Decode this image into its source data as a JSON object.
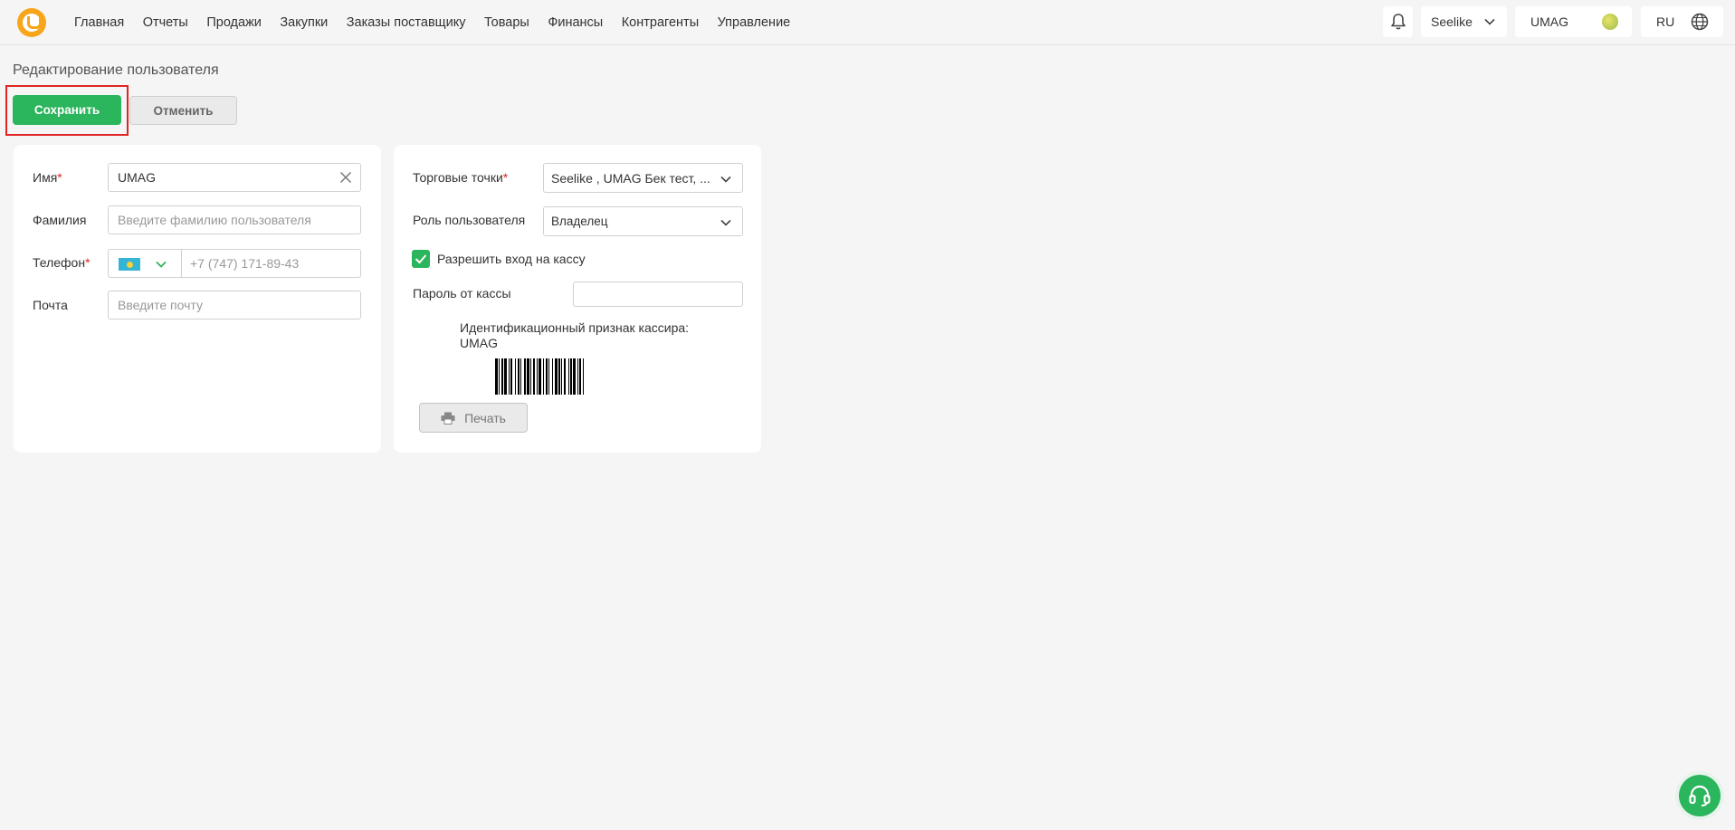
{
  "nav": {
    "items": [
      "Главная",
      "Отчеты",
      "Продажи",
      "Закупки",
      "Заказы поставщику",
      "Товары",
      "Финансы",
      "Контрагенты",
      "Управление"
    ]
  },
  "header": {
    "store": "Seelike",
    "user": "UMAG",
    "lang": "RU"
  },
  "page": {
    "title": "Редактирование пользователя",
    "save_label": "Сохранить",
    "cancel_label": "Отменить"
  },
  "form_left": {
    "name_label": "Имя",
    "name_value": "UMAG",
    "surname_label": "Фамилия",
    "surname_placeholder": "Введите фамилию пользователя",
    "phone_label": "Телефон",
    "phone_placeholder": "+7 (747) 171-89-43",
    "email_label": "Почта",
    "email_placeholder": "Введите почту",
    "required_mark": "*"
  },
  "form_right": {
    "stores_label": "Торговые точки",
    "stores_value": "Seelike , UMAG Бек тест, ...",
    "role_label": "Роль пользователя",
    "role_value": "Владелец",
    "allow_pos_label": "Разрешить вход на кассу",
    "allow_pos_checked": true,
    "pos_password_label": "Пароль от кассы",
    "pos_password_value": "",
    "cashier_id_label": "Идентификационный признак кассира:",
    "cashier_id_value": "UMAG",
    "print_label": "Печать"
  },
  "colors": {
    "accent": "#2bb55c",
    "brand": "#f7a61b",
    "required": "#e02424",
    "highlight_frame": "#e02424"
  },
  "icons": [
    "logo-icon",
    "bell-icon",
    "chevron-down-icon",
    "avatar-icon",
    "globe-icon",
    "close-icon",
    "kz-flag-icon",
    "check-icon",
    "barcode-icon",
    "printer-icon",
    "headset-icon"
  ]
}
